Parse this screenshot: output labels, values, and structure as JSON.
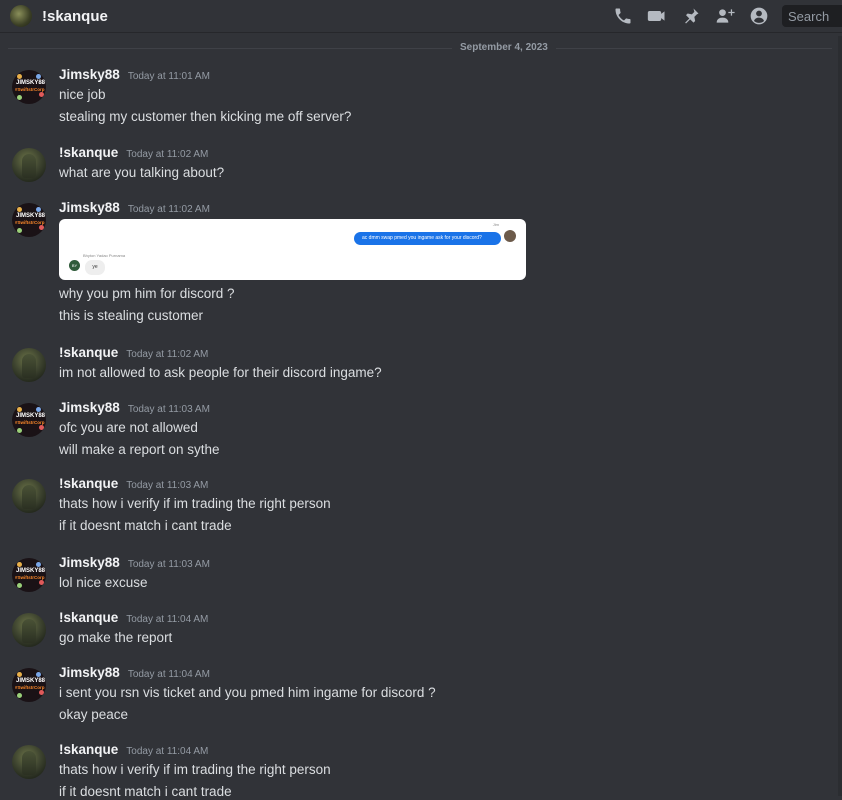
{
  "header": {
    "channel_name": "!skanque",
    "search_placeholder": "Search",
    "icons": [
      "phone-icon",
      "video-icon",
      "pin-icon",
      "add-friend-icon",
      "user-profile-icon"
    ]
  },
  "date_divider": "September 4, 2023",
  "messages": [
    {
      "author": "Jimsky88",
      "time": "Today at 11:01 AM",
      "lines": [
        "nice job",
        "stealing my customer then kicking me off server?"
      ]
    },
    {
      "author": "!skanque",
      "time": "Today at 11:02 AM",
      "lines": [
        "what are you talking about?"
      ]
    },
    {
      "author": "Jimsky88",
      "time": "Today at 11:02 AM",
      "attachment": {
        "right_meta": "Jim",
        "right_text": "ac dmm swap pmed you ingame ask for your discord?",
        "left_meta": "Bhyton Yadao Purnama",
        "left_initials": "BY",
        "left_text": "ye"
      },
      "lines": [
        "why you pm him for discord ?",
        "this is stealing customer"
      ]
    },
    {
      "author": "!skanque",
      "time": "Today at 11:02 AM",
      "lines": [
        "im not allowed to ask people for their discord ingame?"
      ]
    },
    {
      "author": "Jimsky88",
      "time": "Today at 11:03 AM",
      "lines": [
        "ofc you are not allowed",
        "will make a report on sythe"
      ]
    },
    {
      "author": "!skanque",
      "time": "Today at 11:03 AM",
      "lines": [
        "thats how i verify if im trading the right person",
        "if it doesnt match i cant trade"
      ]
    },
    {
      "author": "Jimsky88",
      "time": "Today at 11:03 AM",
      "lines": [
        "lol nice excuse"
      ]
    },
    {
      "author": "!skanque",
      "time": "Today at 11:04 AM",
      "lines": [
        "go make the report"
      ]
    },
    {
      "author": "Jimsky88",
      "time": "Today at 11:04 AM",
      "lines": [
        "i sent you rsn vis ticket and you pmed him ingame for discord ?",
        "okay peace"
      ]
    },
    {
      "author": "!skanque",
      "time": "Today at 11:04 AM",
      "lines": [
        "thats how i verify if im trading the right person",
        "if it doesnt match i cant trade"
      ]
    }
  ],
  "avatar_text": {
    "jimsky_name": "JIMSKY88",
    "jimsky_sub": "#SwiftstrCorp"
  },
  "colors": {
    "background": "#313338",
    "text": "#dbdee1",
    "muted": "#949ba4",
    "author": "#f2f3f5"
  }
}
